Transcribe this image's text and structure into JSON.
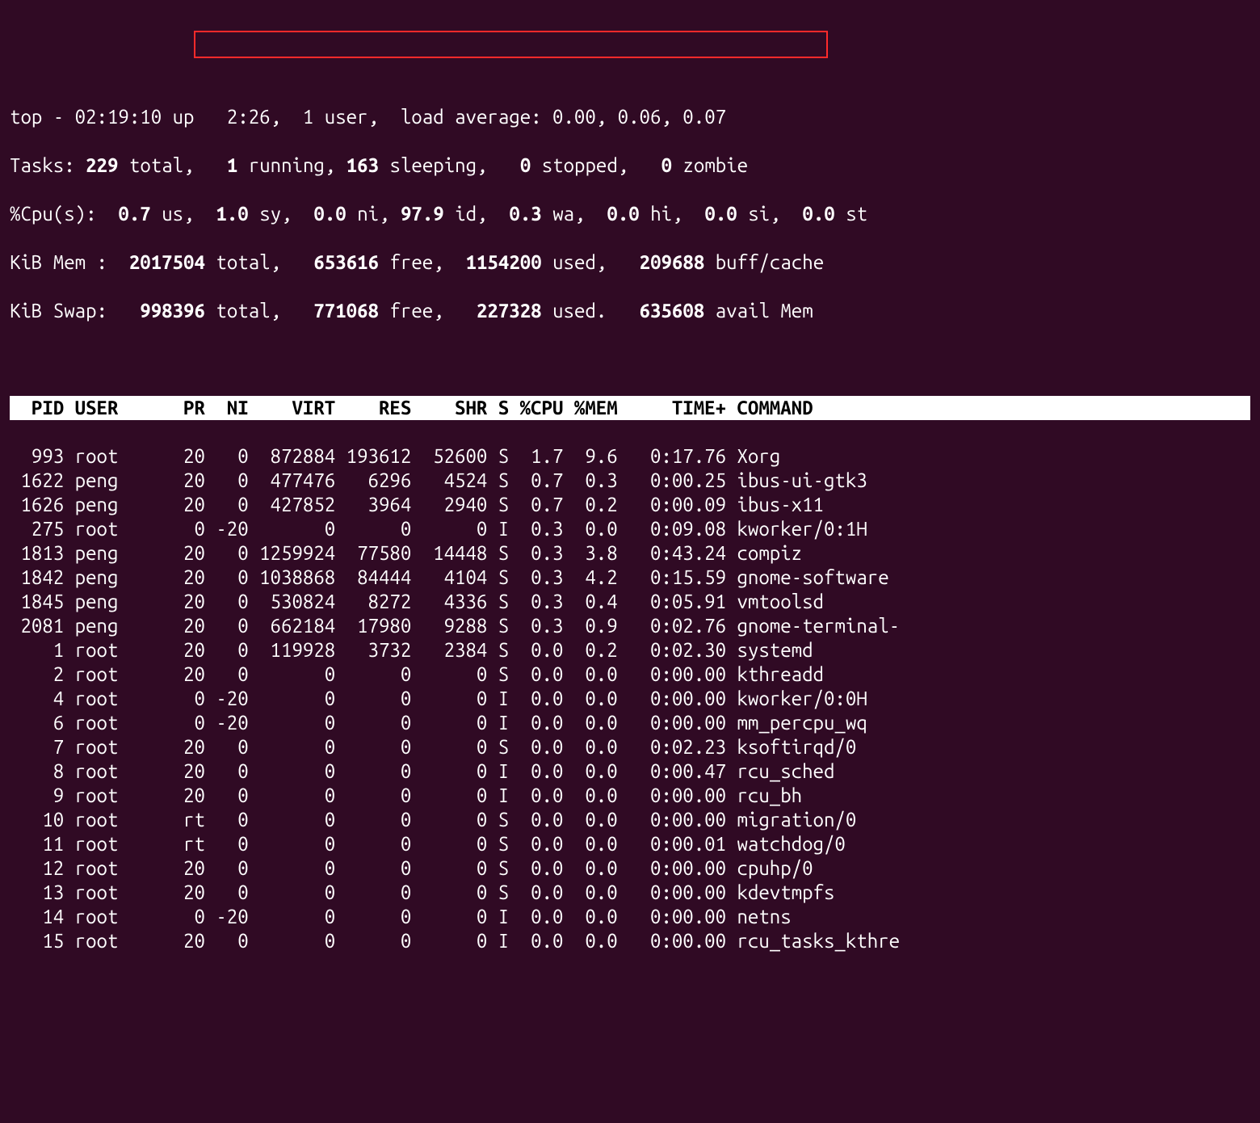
{
  "summary": {
    "line1_pre": "top - ",
    "time": "02:19:10",
    "up_pre": " up ",
    "uptime": "  2:26",
    "users_pre": ",  ",
    "users": "1 user",
    "load_pre": ",  load average: ",
    "load": "0.00, 0.06, 0.07",
    "tasks_label": "Tasks:",
    "tasks_total": "229",
    "tasks_total_lbl": "total,",
    "tasks_running": "1",
    "tasks_running_lbl": "running,",
    "tasks_sleeping": "163",
    "tasks_sleeping_lbl": "sleeping,",
    "tasks_stopped": "0",
    "tasks_stopped_lbl": "stopped,",
    "tasks_zombie": "0",
    "tasks_zombie_lbl": "zombie",
    "cpu_label": "%Cpu(s):",
    "cpu_us": "0.7",
    "cpu_us_lbl": "us,",
    "cpu_sy": "1.0",
    "cpu_sy_lbl": "sy,",
    "cpu_ni": "0.0",
    "cpu_ni_lbl": "ni,",
    "cpu_id": "97.9",
    "cpu_id_lbl": "id,",
    "cpu_wa": "0.3",
    "cpu_wa_lbl": "wa,",
    "cpu_hi": "0.0",
    "cpu_hi_lbl": "hi,",
    "cpu_si": "0.0",
    "cpu_si_lbl": "si,",
    "cpu_st": "0.0",
    "cpu_st_lbl": "st",
    "mem_label": "KiB Mem :",
    "mem_total": "2017504",
    "mem_total_lbl": "total,",
    "mem_free": "653616",
    "mem_free_lbl": "free,",
    "mem_used": "1154200",
    "mem_used_lbl": "used,",
    "mem_buff": "209688",
    "mem_buff_lbl": "buff/cache",
    "swap_label": "KiB Swap:",
    "swap_total": "998396",
    "swap_total_lbl": "total,",
    "swap_free": "771068",
    "swap_free_lbl": "free,",
    "swap_used": "227328",
    "swap_used_lbl": "used.",
    "swap_avail": "635608",
    "swap_avail_lbl": "avail Mem"
  },
  "columns": "  PID USER      PR  NI    VIRT    RES    SHR S %CPU %MEM     TIME+ COMMAND        ",
  "rows": [
    "  993 root      20   0  872884 193612  52600 S  1.7  9.6   0:17.76 Xorg           ",
    " 1622 peng      20   0  477476   6296   4524 S  0.7  0.3   0:00.25 ibus-ui-gtk3   ",
    " 1626 peng      20   0  427852   3964   2940 S  0.7  0.2   0:00.09 ibus-x11       ",
    "  275 root       0 -20       0      0      0 I  0.3  0.0   0:09.08 kworker/0:1H   ",
    " 1813 peng      20   0 1259924  77580  14448 S  0.3  3.8   0:43.24 compiz         ",
    " 1842 peng      20   0 1038868  84444   4104 S  0.3  4.2   0:15.59 gnome-software ",
    " 1845 peng      20   0  530824   8272   4336 S  0.3  0.4   0:05.91 vmtoolsd       ",
    " 2081 peng      20   0  662184  17980   9288 S  0.3  0.9   0:02.76 gnome-terminal-",
    "    1 root      20   0  119928   3732   2384 S  0.0  0.2   0:02.30 systemd        ",
    "    2 root      20   0       0      0      0 S  0.0  0.0   0:00.00 kthreadd       ",
    "    4 root       0 -20       0      0      0 I  0.0  0.0   0:00.00 kworker/0:0H   ",
    "    6 root       0 -20       0      0      0 I  0.0  0.0   0:00.00 mm_percpu_wq   ",
    "    7 root      20   0       0      0      0 S  0.0  0.0   0:02.23 ksoftirqd/0    ",
    "    8 root      20   0       0      0      0 I  0.0  0.0   0:00.47 rcu_sched      ",
    "    9 root      20   0       0      0      0 I  0.0  0.0   0:00.00 rcu_bh         ",
    "   10 root      rt   0       0      0      0 S  0.0  0.0   0:00.00 migration/0    ",
    "   11 root      rt   0       0      0      0 S  0.0  0.0   0:00.01 watchdog/0     ",
    "   12 root      20   0       0      0      0 S  0.0  0.0   0:00.00 cpuhp/0        ",
    "   13 root      20   0       0      0      0 S  0.0  0.0   0:00.00 kdevtmpfs      ",
    "   14 root       0 -20       0      0      0 I  0.0  0.0   0:00.00 netns          ",
    "   15 root      20   0       0      0      0 I  0.0  0.0   0:00.00 rcu_tasks_kthre"
  ]
}
